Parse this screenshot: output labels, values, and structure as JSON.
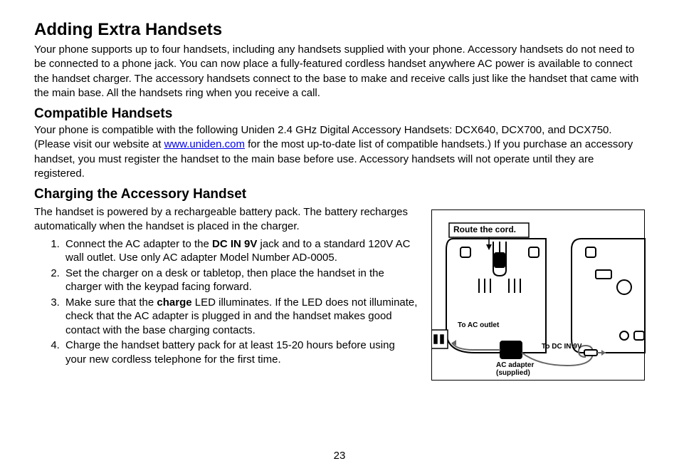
{
  "heading1": "Adding Extra Handsets",
  "para1": "Your phone supports up to four handsets, including any handsets supplied with your phone. Accessory handsets do not need to be connected to a phone jack. You can now place a fully-featured cordless handset anywhere AC power is available to connect the handset charger. The accessory handsets connect to the base to make and receive calls just like the handset that came with the main base. All the handsets ring when you receive a call.",
  "heading2a": "Compatible Handsets",
  "para2_a": "Your phone is compatible with the following Uniden 2.4 GHz Digital Accessory Handsets: DCX640, DCX700, and DCX750. (Please visit our website at ",
  "link_text": "www.uniden.com",
  "link_href": "http://www.uniden.com",
  "para2_b": " for the most up-to-date list of compatible handsets.) If you purchase an accessory handset, you must register the handset to the main base before use. Accessory handsets will not operate until they are registered.",
  "heading2b": "Charging the Accessory Handset",
  "para3": "The handset is powered by a rechargeable battery pack. The battery recharges automatically when the handset is placed in the charger.",
  "steps": {
    "s1_a": "Connect the AC adapter to the ",
    "s1_bold": "DC IN 9V",
    "s1_b": " jack and to a stan­dard 120V AC wall outlet. Use only AC adapter Model Num­ber AD-0005.",
    "s2": "Set the charger on a desk or tabletop, then place the handset in the charger with the keypad facing forward.",
    "s3_a": "Make sure that the ",
    "s3_bold": "charge",
    "s3_b": " LED illuminates. If the LED does not illuminate, check that the AC adapter is plugged in and the handset makes good contact with the base charging contacts.",
    "s4": "Charge the handset battery pack for at least 15-20 hours be­fore using your new cordless telephone for the first time."
  },
  "figure_labels": {
    "route": "Route the cord.",
    "ac_outlet": "To AC outlet",
    "dc_in": "To DC IN 9V",
    "adapter": "AC adapter",
    "supplied": "(supplied)"
  },
  "pagenum": "23"
}
